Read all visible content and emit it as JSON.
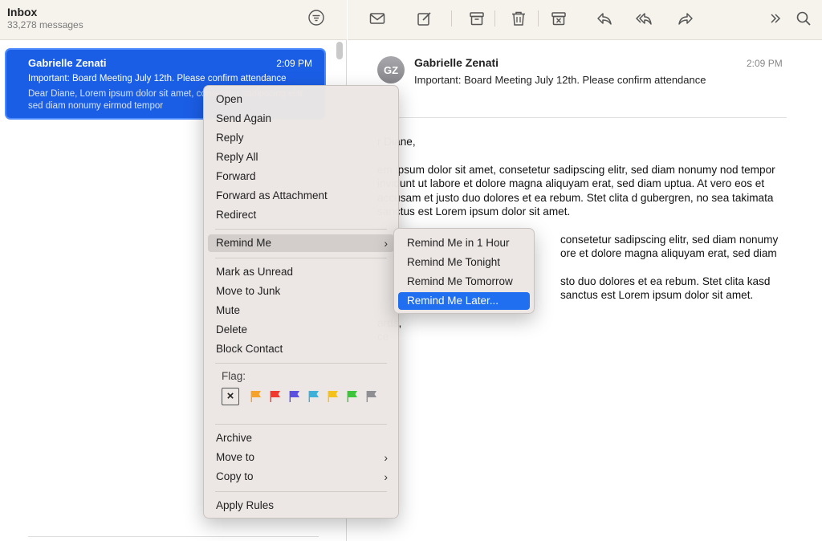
{
  "list_header": {
    "title": "Inbox",
    "count": "33,278 messages",
    "filter_icon": "filter-icon"
  },
  "message_list": [
    {
      "sender": "Gabrielle Zenati",
      "time": "2:09 PM",
      "subject": "Important: Board Meeting July 12th. Please confirm attendance",
      "preview": "Dear Diane, Lorem ipsum dolor sit amet, consetetur sadipscing elitr, sed diam nonumy eirmod tempor"
    }
  ],
  "toolbar": {
    "icons": [
      "compose-envelope-icon",
      "new-message-icon",
      "archive-icon",
      "trash-icon",
      "junk-icon",
      "reply-icon",
      "reply-all-icon",
      "forward-icon",
      "more-chevron-icon",
      "search-icon"
    ]
  },
  "reader": {
    "avatar_initials": "GZ",
    "sender": "Gabrielle Zenati",
    "subject": "Important: Board Meeting July 12th. Please confirm attendance",
    "time": "2:09 PM",
    "body": {
      "greeting": "r Diane,",
      "p1": "em ipsum dolor sit amet, consetetur sadipscing elitr, sed diam nonumy nod tempor invidunt ut labore et dolore magna aliquyam erat, sed diam uptua. At vero eos et accusam et justo duo dolores et ea rebum. Stet clita d gubergren, no sea takimata sanctus est Lorem ipsum dolor sit amet.",
      "p2": "consetetur sadipscing elitr, sed diam nonumy ore et dolore magna aliquyam erat, sed diam",
      "p3": "sto duo dolores et ea rebum. Stet clita kasd sanctus est Lorem ipsum dolor sit amet.",
      "closing": "ards,",
      "signature": "ce"
    }
  },
  "context_menu": {
    "items": {
      "open": "Open",
      "send_again": "Send Again",
      "reply": "Reply",
      "reply_all": "Reply All",
      "forward": "Forward",
      "forward_attachment": "Forward as Attachment",
      "redirect": "Redirect",
      "remind_me": "Remind Me",
      "mark_unread": "Mark as Unread",
      "move_junk": "Move to Junk",
      "mute": "Mute",
      "delete": "Delete",
      "block_contact": "Block Contact",
      "flag_label": "Flag:",
      "archive": "Archive",
      "move_to": "Move to",
      "copy_to": "Copy to",
      "apply_rules": "Apply Rules"
    },
    "flag_colors": [
      "#f5a12a",
      "#f03a2f",
      "#5b4fe0",
      "#3fb0d8",
      "#f4c21a",
      "#3cc43a",
      "#8e8e93"
    ],
    "chevron": "›"
  },
  "submenu": {
    "items": [
      "Remind Me in 1 Hour",
      "Remind Me Tonight",
      "Remind Me Tomorrow",
      "Remind Me Later..."
    ],
    "selected": "Remind Me Later..."
  },
  "colors": {
    "accent": "#1b5ee6",
    "selection": "#1f6ff0"
  }
}
